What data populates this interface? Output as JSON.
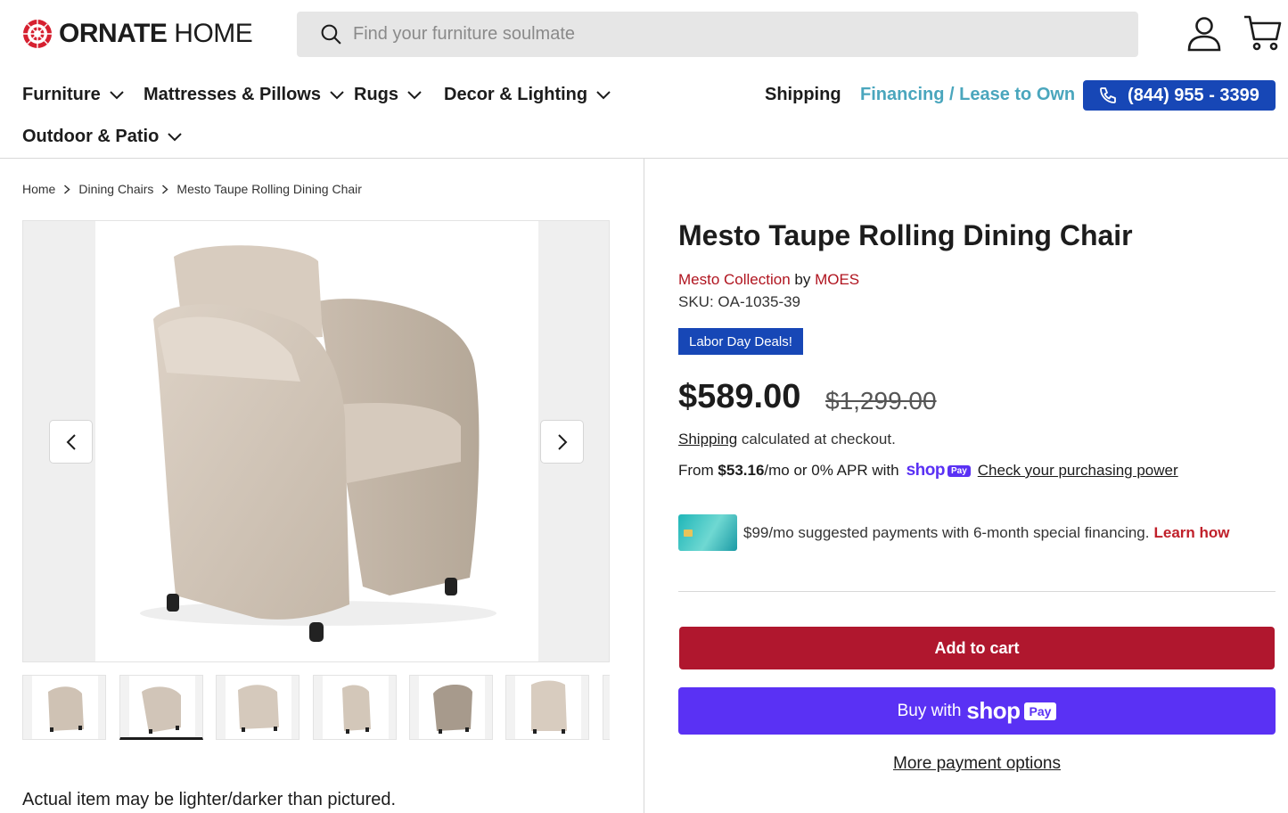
{
  "brand": {
    "name_bold": "ORNATE",
    "name_light": " HOME",
    "accent": "#d62030"
  },
  "search": {
    "placeholder": "Find your furniture soulmate"
  },
  "nav": {
    "items": [
      {
        "label": "Furniture"
      },
      {
        "label": "Mattresses & Pillows"
      },
      {
        "label": "Rugs"
      },
      {
        "label": "Decor & Lighting"
      },
      {
        "label": "Outdoor & Patio"
      }
    ],
    "shipping": "Shipping",
    "financing": "Financing / Lease to Own",
    "phone": "(844) 955 - 3399"
  },
  "breadcrumb": [
    "Home",
    "Dining Chairs",
    "Mesto Taupe Rolling Dining Chair"
  ],
  "gallery": {
    "thumb_count": 7,
    "active_index": 1
  },
  "disclaimer": "Actual item may be lighter/darker than pictured.",
  "product": {
    "title": "Mesto Taupe Rolling Dining Chair",
    "collection": "Mesto Collection",
    "by": " by ",
    "brand": "MOES",
    "sku": "SKU: OA-1035-39",
    "badge": "Labor Day Deals!",
    "price": "$589.00",
    "compare_price": "$1,299.00",
    "shipping_link": "Shipping",
    "shipping_note": " calculated at checkout.",
    "installments": {
      "prefix": "From ",
      "amount": "$53.16",
      "suffix": "/mo or 0% APR with",
      "shop": "shop",
      "pay": "Pay",
      "link": "Check your purchasing power"
    },
    "financing_text": "$99/mo suggested payments with 6-month special financing.",
    "learn_how": "Learn how",
    "add_to_cart": "Add to cart",
    "buy_with": "Buy with",
    "buy_shop": "shop",
    "buy_pay": "Pay",
    "more_payment": "More payment options"
  },
  "colors": {
    "primary_blue": "#1747b6",
    "financing_teal": "#4aa6bd",
    "cart_red": "#b0172e",
    "shop_purple": "#5a31f4",
    "link_red": "#b0141f"
  }
}
